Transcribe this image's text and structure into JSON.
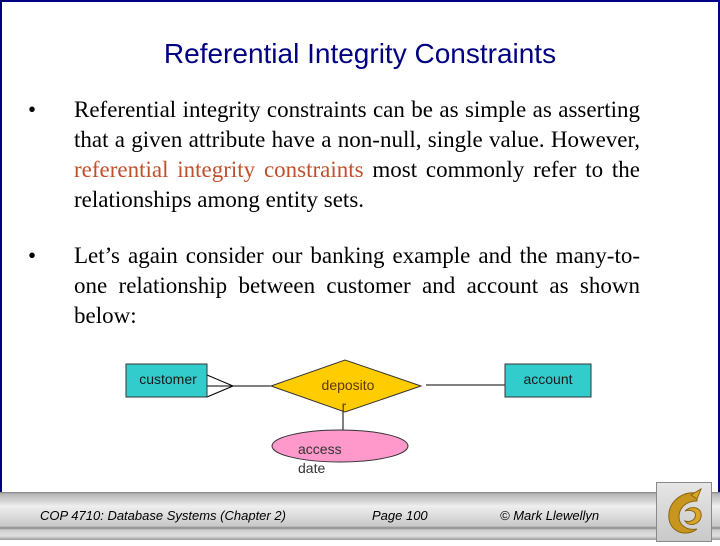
{
  "slide": {
    "title": "Referential Integrity Constraints",
    "bullets": [
      {
        "marker": "•",
        "text_before": "Referential integrity constraints can be as simple as asserting that a given attribute have a non-null, single value.  However, ",
        "highlight": "referential integrity constraints",
        "text_after": " most commonly refer to the relationships among entity sets."
      },
      {
        "marker": "•",
        "text": "Let’s again consider our banking example and the many-to-one relationship between customer and account as shown below:"
      }
    ],
    "diagram": {
      "entities": [
        "customer",
        "account"
      ],
      "relationship": "depositor",
      "relationship_display_lines": [
        "deposito",
        "r"
      ],
      "attribute_lines": [
        "access",
        "date"
      ],
      "colors": {
        "entity_fill": "#33cccc",
        "relationship_fill": "#ffcc00",
        "attribute_fill": "#ff99cc",
        "title": "#000080",
        "highlight": "#c0502c"
      }
    },
    "footer": {
      "course": "COP 4710: Database Systems  (Chapter 2)",
      "page": "Page 100",
      "author": "© Mark Llewellyn",
      "logo": "ucf-pegasus-logo"
    }
  }
}
